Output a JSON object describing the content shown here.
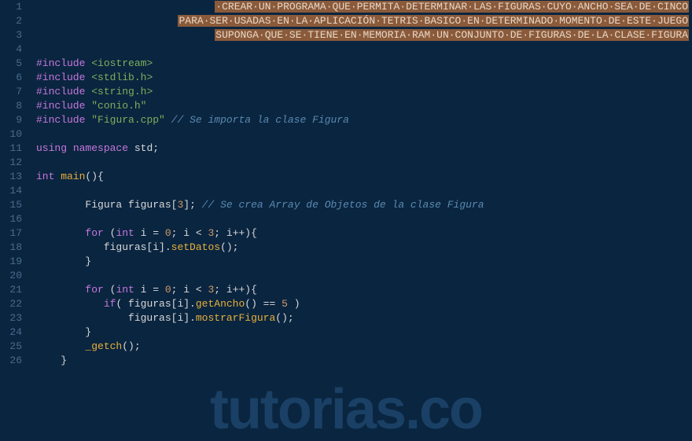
{
  "watermark": "tutorias.co",
  "gutter": {
    "lines": [
      "1",
      "2",
      "3",
      "4",
      "5",
      "6",
      "7",
      "8",
      "9",
      "10",
      "11",
      "12",
      "13",
      "14",
      "15",
      "16",
      "17",
      "18",
      "19",
      "20",
      "21",
      "22",
      "23",
      "24",
      "25",
      "26"
    ]
  },
  "code": {
    "comment_block": {
      "l1": "·CREAR·UN·PROGRAMA·QUE·PERMITA·DETERMINAR·LAS·FIGURAS·CUYO·ANCHO·SEA·DE·CINCO",
      "l2": "PARA·SER·USADAS·EN·LA·APLICACIÓN·TETRIS·BASICO·EN·DETERMINADO·MOMENTO·DE·ESTE·JUEGO",
      "l3": "SUPONGA·QUE·SE·TIENE·EN·MEMORIA·RAM·UN·CONJUNTO·DE·FIGURAS·DE·LA·CLASE·FIGURA"
    },
    "include": "#include",
    "headers": {
      "iostream": "<iostream>",
      "stdlib": "<stdlib.h>",
      "string": "<string.h>",
      "conio": "\"conio.h\"",
      "figura": "\"Figura.cpp\""
    },
    "comment_import": " // Se importa la clase Figura",
    "using": "using",
    "namespace_kw": "namespace",
    "std": " std;",
    "int_kw": "int",
    "main_fn": " main",
    "main_parens": "(){",
    "figura_type": "Figura ",
    "figuras_var": "figuras[",
    "arr_size": "3",
    "arr_close": "];",
    "comment_array": " // Se crea Array de Objetos de la clase Figura",
    "for_kw": "for",
    "for_open": " (",
    "int_i": "int",
    "i_eq": " i = ",
    "zero": "0",
    "semi_cond": "; i < ",
    "three": "3",
    "semi_inc": "; i++){",
    "figuras_i": "figuras[i].",
    "setDatos_fn": "setDatos",
    "call_close": "();",
    "brace_close": "}",
    "if_kw": "if",
    "if_open": "( figuras[i].",
    "getAncho_fn": "getAncho",
    "eq5_open": "() == ",
    "five": "5",
    "eq5_close": " )",
    "mostrar_fn": "mostrarFigura",
    "getch_fn": "_getch",
    "getch_close": "();"
  }
}
